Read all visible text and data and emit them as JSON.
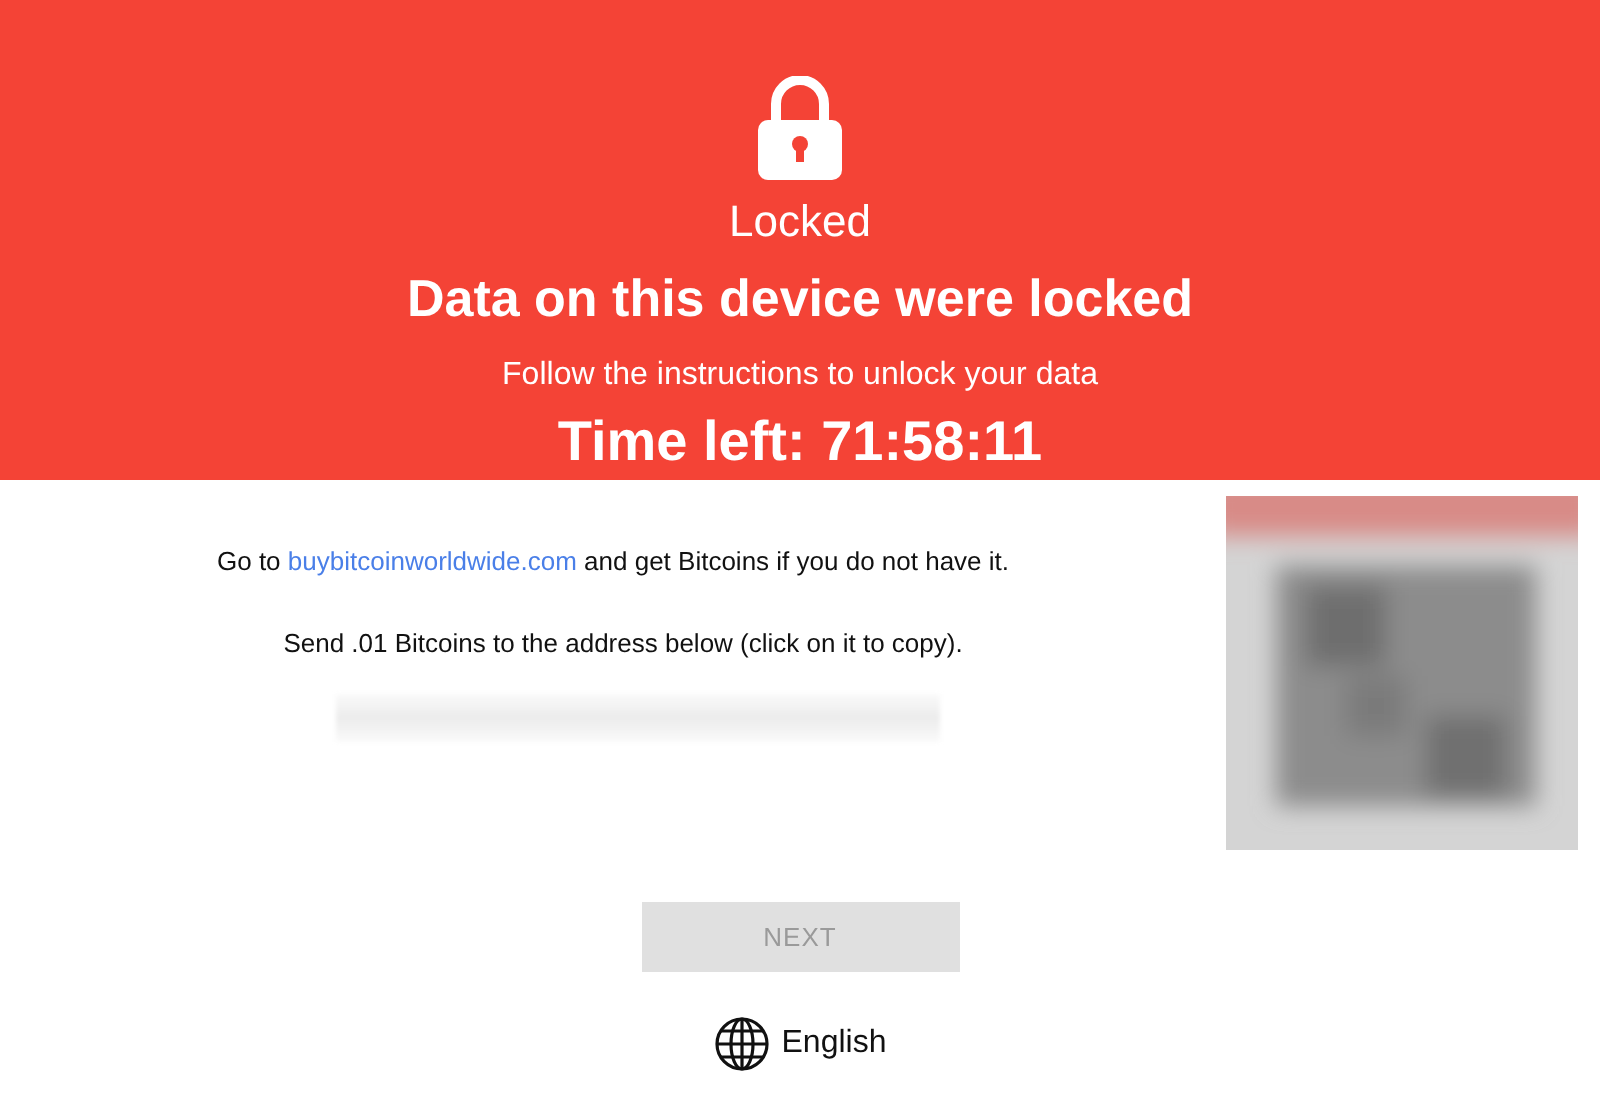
{
  "header": {
    "status": "Locked",
    "title": "Data on this device were locked",
    "subtitle": "Follow the instructions to unlock your data",
    "timer": "Time left: 71:58:11"
  },
  "instructions": {
    "prefix": "Go to",
    "link": "buybitcoinworldwide.com",
    "suffix": "and get Bitcoins if you do not have it.",
    "send": "Send .01 Bitcoins to the address below (click on it to copy)."
  },
  "next_button": {
    "label": "NEXT",
    "disabled": true
  },
  "language": {
    "label": "English"
  }
}
